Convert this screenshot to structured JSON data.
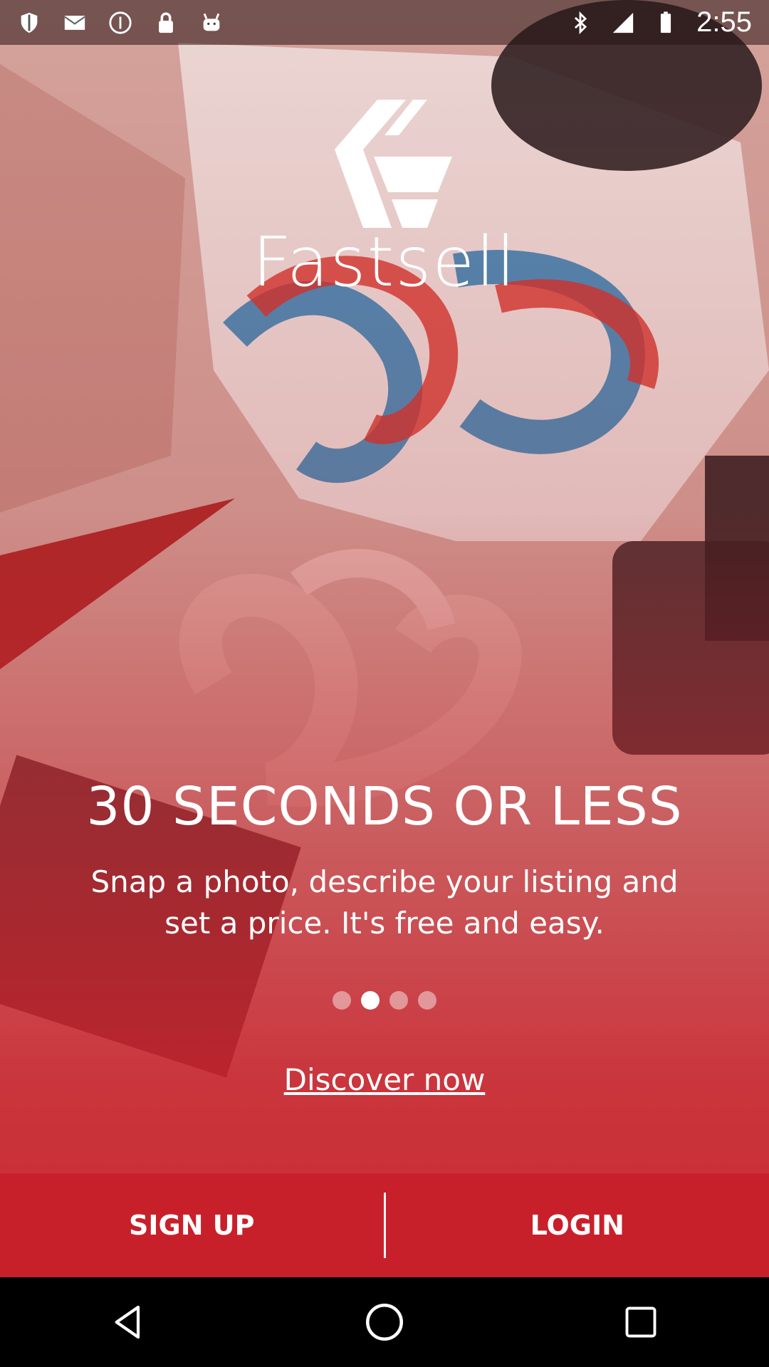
{
  "status_bar": {
    "time": "2:55",
    "icons_left": [
      "shield-icon",
      "mail-icon",
      "info-icon",
      "lock-icon",
      "android-icon"
    ],
    "icons_right": [
      "bluetooth-icon",
      "signal-icon",
      "battery-icon"
    ]
  },
  "brand": {
    "name": "Fastsell"
  },
  "onboarding": {
    "headline": "30 SECONDS OR LESS",
    "subtext": "Snap a photo, describe your listing and set a price. It's free and easy.",
    "pages_total": 4,
    "active_page": 2,
    "discover_link": "Discover now"
  },
  "actions": {
    "signup_label": "SIGN UP",
    "login_label": "LOGIN"
  },
  "nav": {
    "items": [
      "back-icon",
      "home-icon",
      "recents-icon"
    ]
  },
  "colors": {
    "accent": "#c8202a",
    "text": "#ffffff"
  }
}
